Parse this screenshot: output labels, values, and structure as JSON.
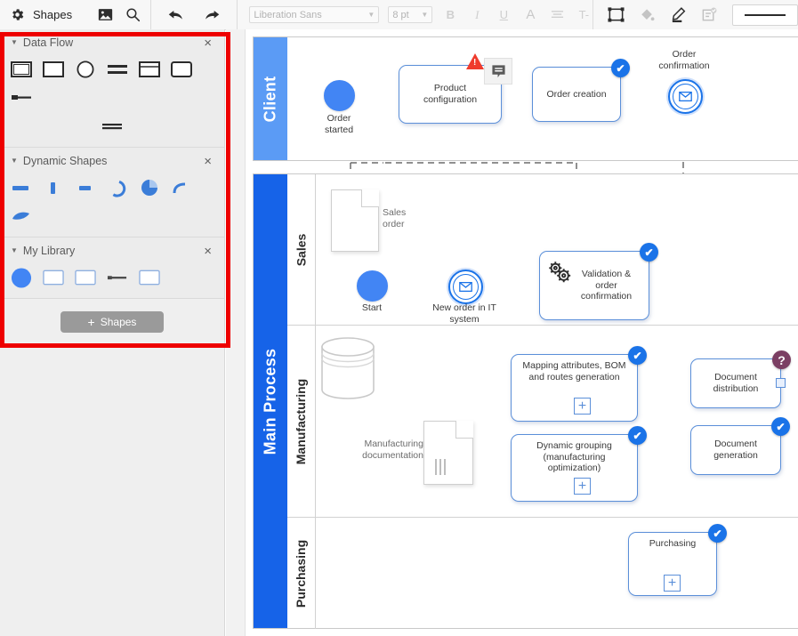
{
  "toolbar": {
    "gear_icon": "gear-icon",
    "title": "Shapes",
    "image_icon": "image-icon",
    "search_icon": "search-icon",
    "undo_icon": "undo-icon",
    "redo_icon": "redo-icon",
    "font_family": "Liberation Sans",
    "font_size": "8 pt",
    "bold": "B",
    "italic": "I",
    "underline": "U",
    "font_color": "A",
    "align": "align-icon",
    "text_format": "T-",
    "shape_outline_icon": "shape-outline-icon",
    "fill_icon": "fill-bucket-icon",
    "line_color_icon": "pen-line-color-icon",
    "style_icon": "style-check-icon",
    "line_style_label": "line-style-preview"
  },
  "panel": {
    "highlight_color": "#ee0000",
    "sections": [
      {
        "title": "Data Flow",
        "close": "×",
        "shapes": [
          "double-rect-shape",
          "rect-shape",
          "circle-shape",
          "two-lines-shape",
          "rect-top-divider-shape",
          "rounded-rect-shape",
          "bar-line-shape",
          "thin-double-line-shape"
        ]
      },
      {
        "title": "Dynamic Shapes",
        "close": "×",
        "shapes": [
          "horizontal-bar-shape",
          "vertical-bar-shape",
          "small-bar-shape",
          "arc-ring-shape",
          "pie-slice-shape",
          "curve-shape",
          "leaf-shape"
        ]
      },
      {
        "title": "My Library",
        "close": "×",
        "shapes": [
          "blue-circle-shape",
          "rect-shape-1",
          "rect-shape-2",
          "connector-line-shape",
          "rect-shape-3"
        ]
      }
    ],
    "shapes_button": {
      "plus": "+",
      "label": "Shapes"
    }
  },
  "diagram": {
    "pools": [
      {
        "name": "Client",
        "color": "#5b9bf5"
      },
      {
        "name": "Main Process",
        "color": "#1663e8"
      }
    ],
    "lanes": [
      "Sales",
      "Manufacturing",
      "Purchasing"
    ],
    "nodes": {
      "order_started": "Order\nstarted",
      "product_configuration": "Product\nconfiguration",
      "order_creation": "Order creation",
      "order_confirmation": "Order\nconfirmation",
      "sales_order": "Sales\norder",
      "start": "Start",
      "new_order_it": "New order in IT\nsystem",
      "validation_order_confirmation": "Validation &\norder\nconfirmation",
      "manufacturing_documentation": "Manufacturing\ndocumentation",
      "mapping_attributes": "Mapping attributes, BOM\nand routes generation",
      "dynamic_grouping": "Dynamic grouping\n(manufacturing optimization)",
      "document_distribution": "Document\ndistribution",
      "document_generation": "Document\ngeneration",
      "purchasing": "Purchasing"
    },
    "badges": {
      "check": "✔",
      "question": "?",
      "warning": "!",
      "subprocess": "+",
      "envelope": "envelope-icon",
      "gears": "gears-icon",
      "database": "database-icon",
      "comment": "comment-icon"
    }
  }
}
